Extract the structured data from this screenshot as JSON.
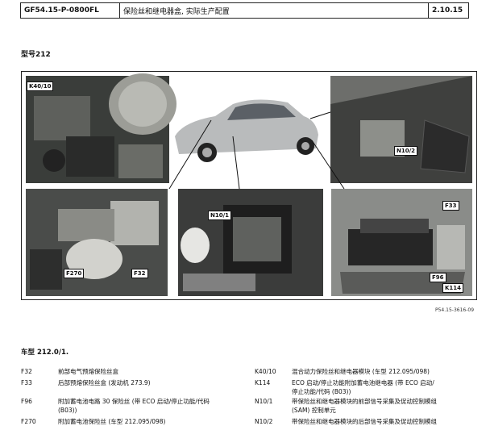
{
  "header": {
    "doc_id": "GF54.15-P-0800FL",
    "title": "保险丝和继电器盒, 实际生产配置",
    "version": "2.10.15"
  },
  "model_label": "型号212",
  "figure": {
    "ref": "P54.15-3616-09",
    "callouts": {
      "k40": "K40/10",
      "n10_2": "N10/2",
      "f270": "F270",
      "f32": "F32",
      "n10_1": "N10/1",
      "f33": "F33",
      "f96": "F96",
      "k114": "K114"
    }
  },
  "subtitle": "车型 212.0/1.",
  "legend_left": [
    {
      "code": "F32",
      "desc": "前部电气预熔保险丝盒"
    },
    {
      "code": "F33",
      "desc": "后部预熔保险丝盒 (发动机 273.9)"
    },
    {
      "code": "F96",
      "desc": "附加蓄电池电路 30 保险丝 (带 ECO 启动/停止功能/代码"
    },
    {
      "code": "",
      "desc": "(B03))"
    },
    {
      "code": "F270",
      "desc": "附加蓄电池保险丝 (车型 212.095/098)"
    }
  ],
  "legend_right": [
    {
      "code": "K40/10",
      "desc": "混合动力保险丝和继电器模块 (车型 212.095/098)"
    },
    {
      "code": "K114",
      "desc": "ECO 启动/停止功能附加蓄电池继电器 (带 ECO 启动/"
    },
    {
      "code": "",
      "desc": "停止功能/代码 (B03))"
    },
    {
      "code": "N10/1",
      "desc": "带保险丝和继电器模块的前部信号采集及促动控制模组"
    },
    {
      "code": "",
      "desc": "(SAM) 控制单元"
    },
    {
      "code": "N10/2",
      "desc": "带保险丝和继电器模块的后部信号采集及促动控制模组"
    }
  ]
}
